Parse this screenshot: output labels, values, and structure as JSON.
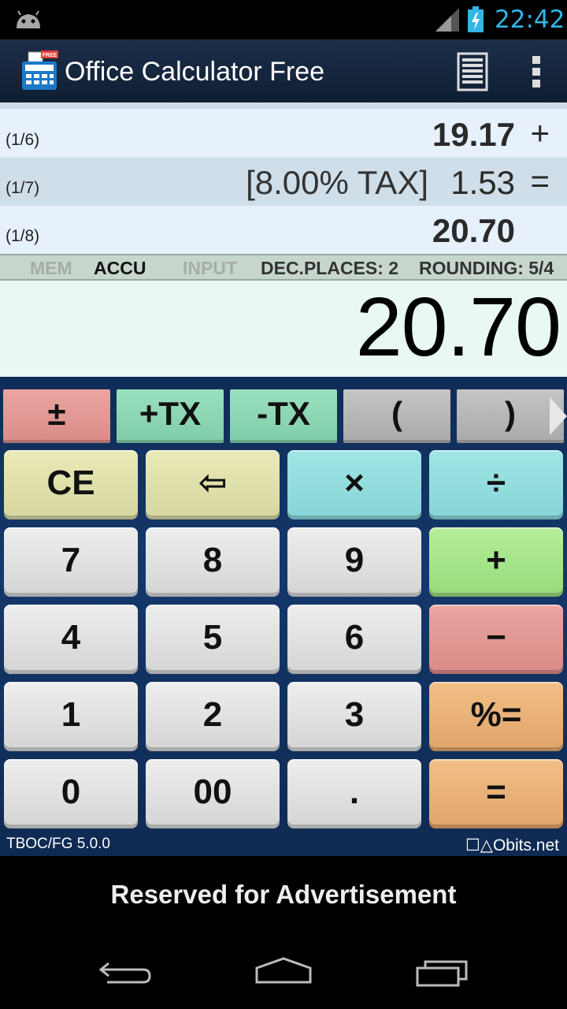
{
  "status": {
    "time": "22:42"
  },
  "app": {
    "title": "Office Calculator Free",
    "icon_badge": "FREE"
  },
  "tape": {
    "rows": [
      {
        "index": "(1/6)",
        "tax": "",
        "value": "19.17",
        "op": "+",
        "bold": true
      },
      {
        "index": "(1/7)",
        "tax": "[8.00% TAX]",
        "value": "1.53",
        "op": "=",
        "bold": false
      },
      {
        "index": "(1/8)",
        "tax": "",
        "value": "20.70",
        "op": "",
        "bold": true
      }
    ]
  },
  "info": {
    "mem": "MEM",
    "accu": "ACCU",
    "input": "INPUT",
    "dec_places": "DEC.PLACES: 2",
    "rounding": "ROUNDING: 5/4"
  },
  "display": {
    "value": "20.70"
  },
  "function_keys": [
    "±",
    "+TX",
    "-TX",
    "(",
    ")"
  ],
  "keys": {
    "ce": "CE",
    "backspace": "⇦",
    "multiply": "×",
    "divide": "÷",
    "k7": "7",
    "k8": "8",
    "k9": "9",
    "plus": "+",
    "k4": "4",
    "k5": "5",
    "k6": "6",
    "minus": "−",
    "k1": "1",
    "k2": "2",
    "k3": "3",
    "percent_equals": "%=",
    "k0": "0",
    "k00": "00",
    "dot": ".",
    "equals": "="
  },
  "footer": {
    "version": "TBOC/FG 5.0.0",
    "brand": "☐△Obits.net"
  },
  "ad": {
    "text": "Reserved for Advertisement"
  },
  "colors": {
    "accent": "#33b5e5",
    "action_bar": "#1c2f49",
    "keypad_bg": "#14386b",
    "display_bg": "#e9f8f0"
  },
  "icons": [
    "android-icon",
    "signal-icon",
    "battery-charging-icon",
    "app-calculator-icon",
    "tape-icon",
    "overflow-menu-icon",
    "scroll-right-icon",
    "back-icon",
    "home-icon",
    "recents-icon"
  ]
}
